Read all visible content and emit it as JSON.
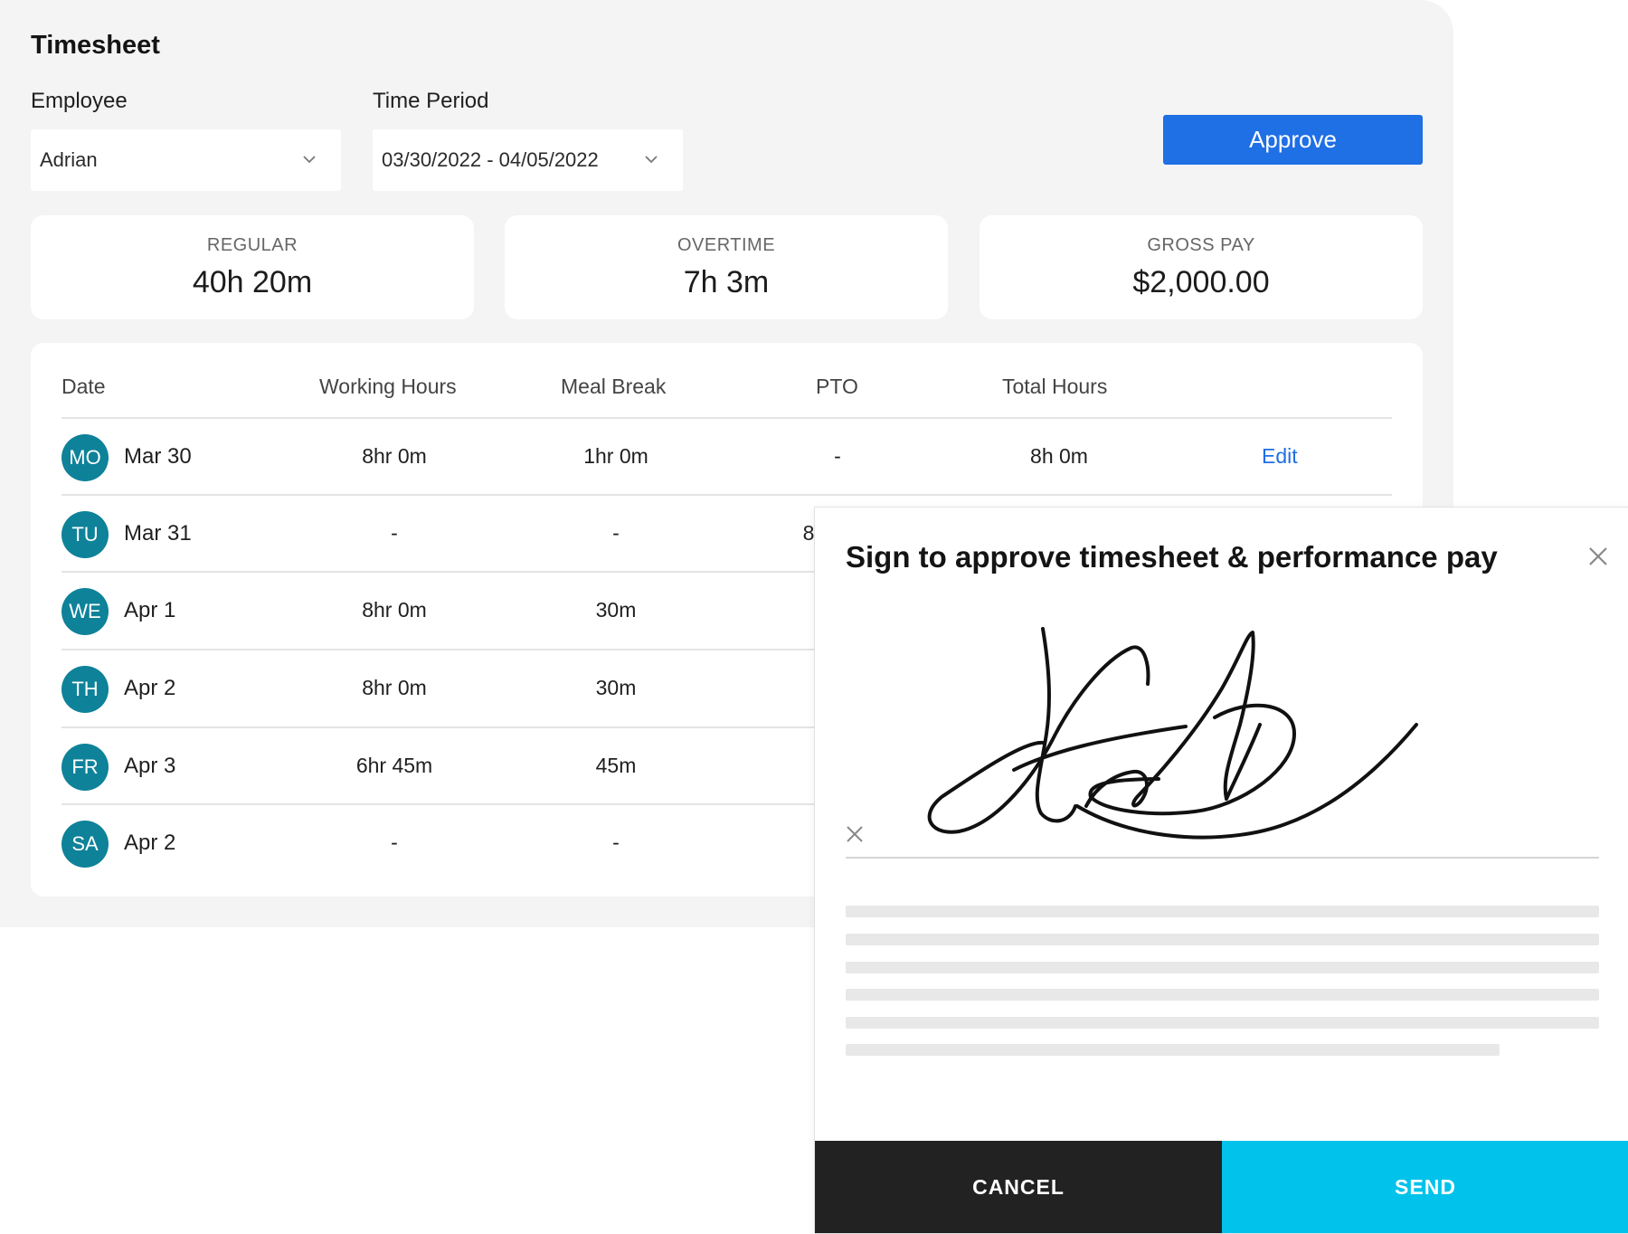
{
  "page": {
    "title": "Timesheet"
  },
  "filters": {
    "employee_label": "Employee",
    "employee_value": "Adrian",
    "period_label": "Time Period",
    "period_value": "03/30/2022 - 04/05/2022"
  },
  "approve_label": "Approve",
  "stats": [
    {
      "label": "REGULAR",
      "value": "40h 20m"
    },
    {
      "label": "OVERTIME",
      "value": "7h 3m"
    },
    {
      "label": "GROSS PAY",
      "value": "$2,000.00"
    }
  ],
  "table": {
    "headers": [
      "Date",
      "Working Hours",
      "Meal Break",
      "PTO",
      "Total Hours"
    ],
    "rows": [
      {
        "day": "MO",
        "date": "Mar 30",
        "working": "8hr 0m",
        "meal": "1hr 0m",
        "pto": "-",
        "total": "8h 0m",
        "action": "Edit"
      },
      {
        "day": "TU",
        "date": "Mar 31",
        "working": "-",
        "meal": "-",
        "pto": "8",
        "total": "",
        "action": ""
      },
      {
        "day": "WE",
        "date": "Apr 1",
        "working": "8hr 0m",
        "meal": "30m",
        "pto": "",
        "total": "",
        "action": ""
      },
      {
        "day": "TH",
        "date": "Apr 2",
        "working": "8hr 0m",
        "meal": "30m",
        "pto": "",
        "total": "",
        "action": ""
      },
      {
        "day": "FR",
        "date": "Apr 3",
        "working": "6hr 45m",
        "meal": "45m",
        "pto": "",
        "total": "",
        "action": ""
      },
      {
        "day": "SA",
        "date": "Apr 2",
        "working": "-",
        "meal": "-",
        "pto": "",
        "total": "",
        "action": ""
      }
    ]
  },
  "modal": {
    "title": "Sign to approve timesheet & performance pay",
    "cancel_label": "CANCEL",
    "send_label": "SEND"
  },
  "icons": {
    "dropdown": "chevron-down-icon",
    "close": "close-icon",
    "clear_signature": "clear-icon"
  },
  "colors": {
    "primary": "#1f6fe5",
    "avatar": "#0e8299",
    "send": "#00c2ea",
    "cancel": "#222222"
  }
}
